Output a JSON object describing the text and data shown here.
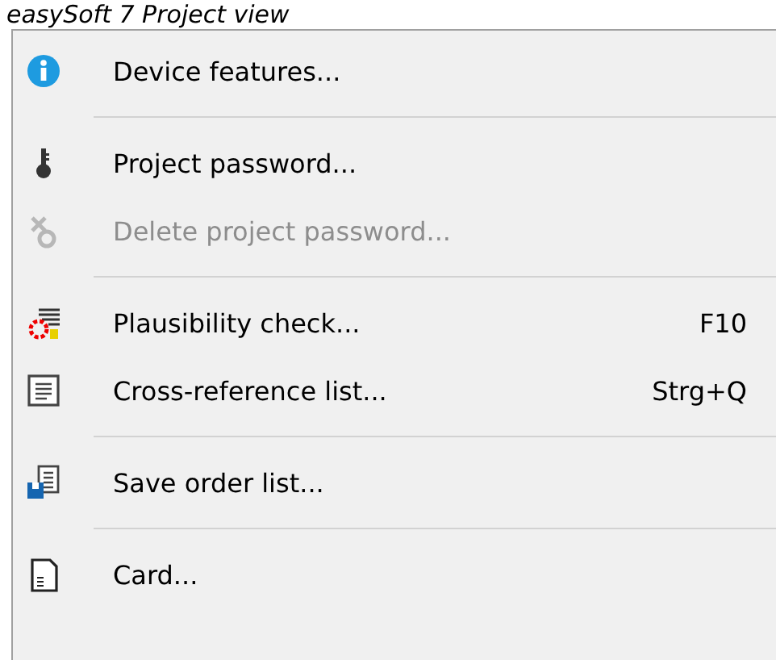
{
  "caption": "easySoft 7 Project view",
  "menu": [
    {
      "kind": "item",
      "label": "Device features...",
      "disabled": false
    },
    {
      "kind": "separator"
    },
    {
      "kind": "item",
      "label": "Project password...",
      "disabled": false
    },
    {
      "kind": "item",
      "label": "Delete project password...",
      "disabled": true
    },
    {
      "kind": "separator"
    },
    {
      "kind": "item",
      "label": "Plausibility check...",
      "shortcut": "F10",
      "disabled": false
    },
    {
      "kind": "item",
      "label": "Cross-reference list...",
      "shortcut": "Strg+Q",
      "disabled": false
    },
    {
      "kind": "separator"
    },
    {
      "kind": "item",
      "label": "Save order list...",
      "disabled": false
    },
    {
      "kind": "separator"
    },
    {
      "kind": "item",
      "label": "Card...",
      "disabled": false
    }
  ]
}
